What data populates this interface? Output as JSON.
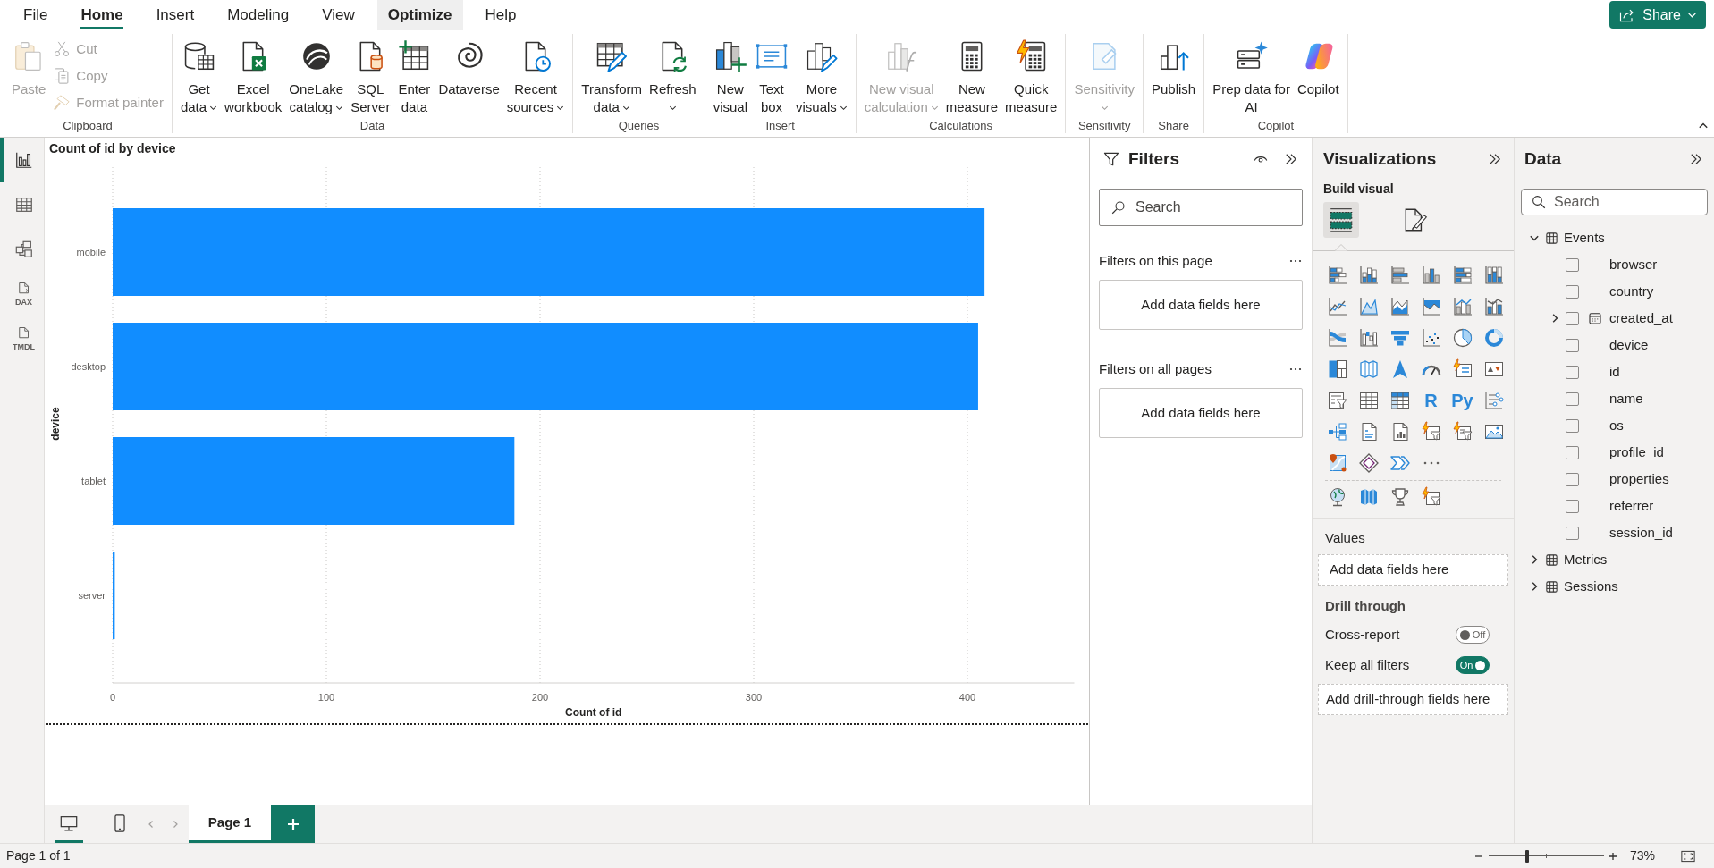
{
  "menu_tabs": [
    {
      "label": "File",
      "selected": false,
      "hovered": false
    },
    {
      "label": "Home",
      "selected": true,
      "hovered": false
    },
    {
      "label": "Insert",
      "selected": false,
      "hovered": false
    },
    {
      "label": "Modeling",
      "selected": false,
      "hovered": false
    },
    {
      "label": "View",
      "selected": false,
      "hovered": false
    },
    {
      "label": "Optimize",
      "selected": false,
      "hovered": true
    },
    {
      "label": "Help",
      "selected": false,
      "hovered": false
    }
  ],
  "share_button": {
    "label": "Share"
  },
  "ribbon": {
    "groups": [
      {
        "label": "Clipboard",
        "buttons": [
          {
            "kind": "large",
            "lines": [
              "Paste"
            ],
            "dropdown": false,
            "disabled": true
          },
          {
            "kind": "small",
            "lines": [
              "Cut"
            ],
            "dropdown": false,
            "disabled": true
          },
          {
            "kind": "small",
            "lines": [
              "Copy"
            ],
            "dropdown": false,
            "disabled": true
          },
          {
            "kind": "small",
            "lines": [
              "Format painter"
            ],
            "dropdown": false,
            "disabled": true
          }
        ]
      },
      {
        "label": "Data",
        "buttons": [
          {
            "kind": "large",
            "lines": [
              "Get",
              "data"
            ],
            "dropdown": true,
            "disabled": false
          },
          {
            "kind": "large",
            "lines": [
              "Excel",
              "workbook"
            ],
            "dropdown": false,
            "disabled": false
          },
          {
            "kind": "large",
            "lines": [
              "OneLake",
              "catalog"
            ],
            "dropdown": true,
            "disabled": false
          },
          {
            "kind": "large",
            "lines": [
              "SQL",
              "Server"
            ],
            "dropdown": false,
            "disabled": false
          },
          {
            "kind": "large",
            "lines": [
              "Enter",
              "data"
            ],
            "dropdown": false,
            "disabled": false
          },
          {
            "kind": "large",
            "lines": [
              "Dataverse"
            ],
            "dropdown": false,
            "disabled": false
          },
          {
            "kind": "large",
            "lines": [
              "Recent",
              "sources"
            ],
            "dropdown": true,
            "disabled": false
          }
        ]
      },
      {
        "label": "Queries",
        "buttons": [
          {
            "kind": "large",
            "lines": [
              "Transform",
              "data"
            ],
            "dropdown": true,
            "disabled": false
          },
          {
            "kind": "large",
            "lines": [
              "Refresh"
            ],
            "dropdown": true,
            "disabled": false
          }
        ]
      },
      {
        "label": "Insert",
        "buttons": [
          {
            "kind": "large",
            "lines": [
              "New",
              "visual"
            ],
            "dropdown": false,
            "disabled": false
          },
          {
            "kind": "large",
            "lines": [
              "Text",
              "box"
            ],
            "dropdown": false,
            "disabled": false
          },
          {
            "kind": "large",
            "lines": [
              "More",
              "visuals"
            ],
            "dropdown": true,
            "disabled": false
          }
        ]
      },
      {
        "label": "Calculations",
        "buttons": [
          {
            "kind": "large",
            "lines": [
              "New visual",
              "calculation"
            ],
            "dropdown": true,
            "disabled": true
          },
          {
            "kind": "large",
            "lines": [
              "New",
              "measure"
            ],
            "dropdown": false,
            "disabled": false
          },
          {
            "kind": "large",
            "lines": [
              "Quick",
              "measure"
            ],
            "dropdown": false,
            "disabled": false
          }
        ]
      },
      {
        "label": "Sensitivity",
        "buttons": [
          {
            "kind": "large",
            "lines": [
              "Sensitivity"
            ],
            "dropdown": true,
            "disabled": true
          }
        ]
      },
      {
        "label": "Share",
        "buttons": [
          {
            "kind": "large",
            "lines": [
              "Publish"
            ],
            "dropdown": false,
            "disabled": false
          }
        ]
      },
      {
        "label": "Copilot",
        "buttons": [
          {
            "kind": "large",
            "lines": [
              "Prep data for",
              "AI"
            ],
            "dropdown": false,
            "disabled": false
          },
          {
            "kind": "large",
            "lines": [
              "Copilot"
            ],
            "dropdown": false,
            "disabled": false
          }
        ]
      }
    ]
  },
  "left_nav": [
    {
      "kind": "report",
      "selected": true
    },
    {
      "kind": "table",
      "selected": false
    },
    {
      "kind": "model",
      "selected": false
    },
    {
      "kind": "dax",
      "label": "DAX",
      "selected": false
    },
    {
      "kind": "tmdl",
      "label": "TMDL",
      "selected": false
    }
  ],
  "visual": {
    "chart_data": {
      "type": "bar",
      "orientation": "horizontal",
      "title": "Count of id by device",
      "xlabel": "Count of id",
      "ylabel": "device",
      "categories": [
        "mobile",
        "desktop",
        "tablet",
        "server"
      ],
      "series": [
        {
          "color": "#118dff",
          "values": [
            408,
            405,
            188,
            1
          ]
        }
      ],
      "xlim": [
        0,
        450
      ],
      "xticks": [
        0,
        100,
        200,
        300,
        400
      ],
      "grid": true
    }
  },
  "page_tabs": {
    "views": [
      {
        "kind": "desktop",
        "selected": true
      },
      {
        "kind": "mobile",
        "selected": false
      }
    ],
    "pages": [
      {
        "label": "Page 1",
        "selected": true
      }
    ]
  },
  "filters_pane": {
    "title": "Filters",
    "search": {
      "placeholder": "Search"
    },
    "sections": [
      {
        "title": "Filters on this page",
        "drop_zone": "Add data fields here"
      },
      {
        "title": "Filters on all pages",
        "drop_zone": "Add data fields here"
      }
    ]
  },
  "visualizations_pane": {
    "title": "Visualizations",
    "subtitle": "Build visual",
    "modes": [
      {
        "kind": "build",
        "selected": true
      },
      {
        "kind": "format",
        "selected": false
      }
    ],
    "script_visuals": [
      "R",
      "Py"
    ],
    "values": {
      "label": "Values",
      "drop_zone": "Add data fields here"
    },
    "drill_through": {
      "title": "Drill through",
      "toggles": [
        {
          "label": "Cross-report",
          "on": false,
          "state_label": "Off"
        },
        {
          "label": "Keep all filters",
          "on": true,
          "state_label": "On"
        }
      ],
      "drop_zone": "Add drill-through fields here"
    }
  },
  "data_pane": {
    "title": "Data",
    "search": {
      "placeholder": "Search"
    },
    "tables": [
      {
        "name": "Events",
        "expanded": true,
        "children": [
          {
            "name": "browser",
            "kind": "column",
            "checked": false
          },
          {
            "name": "country",
            "kind": "column",
            "checked": false
          },
          {
            "name": "created_at",
            "kind": "date",
            "expanded": false,
            "checked": false
          },
          {
            "name": "device",
            "kind": "column",
            "checked": false
          },
          {
            "name": "id",
            "kind": "column",
            "checked": false
          },
          {
            "name": "name",
            "kind": "column",
            "checked": false
          },
          {
            "name": "os",
            "kind": "column",
            "checked": false
          },
          {
            "name": "profile_id",
            "kind": "column",
            "checked": false
          },
          {
            "name": "properties",
            "kind": "column",
            "checked": false
          },
          {
            "name": "referrer",
            "kind": "column",
            "checked": false
          },
          {
            "name": "session_id",
            "kind": "column",
            "checked": false
          }
        ]
      },
      {
        "name": "Metrics",
        "expanded": false
      },
      {
        "name": "Sessions",
        "expanded": false
      }
    ]
  },
  "status_bar": {
    "page_info": "Page 1 of 1",
    "zoom": {
      "level": 0.33,
      "reading": "73%"
    }
  }
}
